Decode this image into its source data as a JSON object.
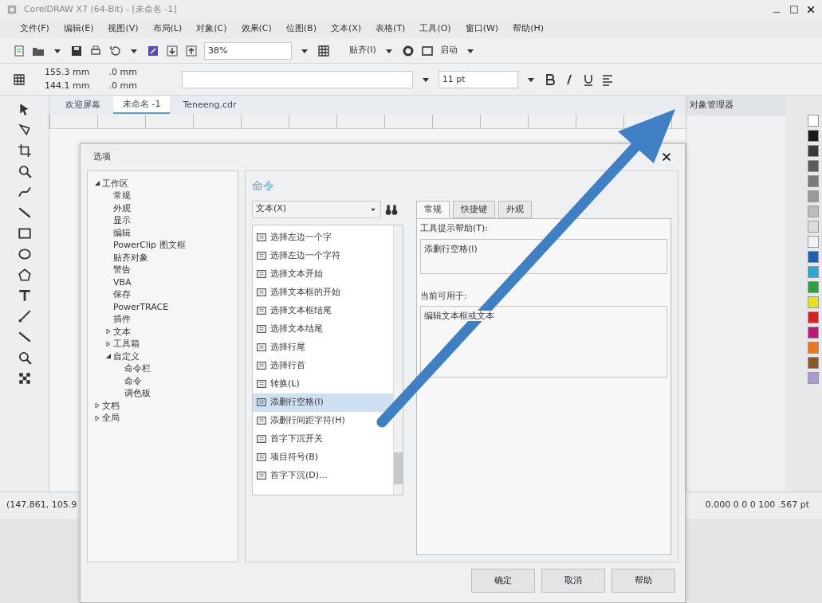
{
  "window": {
    "title": "CorelDRAW X7 (64-Bit) - [未命名 -1]"
  },
  "menu": [
    "文件(F)",
    "编辑(E)",
    "视图(V)",
    "布局(L)",
    "对象(C)",
    "效果(C)",
    "位图(B)",
    "文本(X)",
    "表格(T)",
    "工具(O)",
    "窗口(W)",
    "帮助(H)"
  ],
  "toolbar": {
    "zoom": "38%",
    "snap": "贴齐(I)",
    "launch": "启动"
  },
  "property_bar": {
    "width": "155.3 mm",
    "height": "144.1 mm",
    "offset_x": ".0 mm",
    "offset_y": ".0 mm",
    "font_size": "11 pt"
  },
  "doc_tabs": [
    {
      "label": "欢迎屏幕",
      "selected": false
    },
    {
      "label": "未命名 -1",
      "selected": true
    },
    {
      "label": "Teneeng.cdr",
      "selected": false
    }
  ],
  "docker": {
    "title": "对象管理器"
  },
  "palette": [
    {
      "color": "#ffffff"
    },
    {
      "color": "#1a1a1a"
    },
    {
      "color": "#3a3a3a"
    },
    {
      "color": "#5a5a5a"
    },
    {
      "color": "#7a7a7a"
    },
    {
      "color": "#9a9a9a"
    },
    {
      "color": "#bdbdbd"
    },
    {
      "color": "#dcdcdc"
    },
    {
      "color": "#f2f2f2"
    },
    {
      "color": "#1e5fb4"
    },
    {
      "color": "#2aa7d6"
    },
    {
      "color": "#2e9e3e"
    },
    {
      "color": "#e8e21c"
    },
    {
      "color": "#d61f26"
    },
    {
      "color": "#c0167a"
    },
    {
      "color": "#e97a1a"
    },
    {
      "color": "#8a5a2b"
    },
    {
      "color": "#a99bd0"
    }
  ],
  "status_bar": {
    "coordinates": "(147.861, 105.9",
    "fill_info": "0.000 0 0 0 100 .567 pt"
  },
  "dialog": {
    "title": "选项",
    "tree": [
      {
        "label": "工作区",
        "expanded": true,
        "children": [
          {
            "label": "常规"
          },
          {
            "label": "外观"
          },
          {
            "label": "显示"
          },
          {
            "label": "编辑"
          },
          {
            "label": "PowerClip 图文框"
          },
          {
            "label": "贴齐对象"
          },
          {
            "label": "警告"
          },
          {
            "label": "VBA"
          },
          {
            "label": "保存"
          },
          {
            "label": "PowerTRACE"
          },
          {
            "label": "插件"
          },
          {
            "label": "文本",
            "expanded": false
          },
          {
            "label": "工具箱",
            "expanded": false
          },
          {
            "label": "自定义",
            "expanded": true,
            "children": [
              {
                "label": "命令栏"
              },
              {
                "label": "命令"
              },
              {
                "label": "调色板"
              }
            ]
          }
        ]
      },
      {
        "label": "文档",
        "expanded": false
      },
      {
        "label": "全局",
        "expanded": false
      }
    ],
    "section_title": "命令",
    "category": "文本(X)",
    "commands": [
      {
        "label": "选择左边一个字",
        "selected": false
      },
      {
        "label": "选择左边一个字符",
        "selected": false
      },
      {
        "label": "选择文本开始",
        "selected": false
      },
      {
        "label": "选择文本框的开始",
        "selected": false
      },
      {
        "label": "选择文本框结尾",
        "selected": false
      },
      {
        "label": "选择文本结尾",
        "selected": false
      },
      {
        "label": "选择行尾",
        "selected": false
      },
      {
        "label": "选择行首",
        "selected": false
      },
      {
        "label": "转换(L)",
        "selected": false
      },
      {
        "label": "添删行空格(I)",
        "selected": true
      },
      {
        "label": "添删行间距字符(H)",
        "selected": false
      },
      {
        "label": "首字下沉开关",
        "selected": false
      },
      {
        "label": "项目符号(B)",
        "selected": false
      },
      {
        "label": "首字下沉(D)...",
        "selected": false
      }
    ],
    "tabs": [
      {
        "label": "常规",
        "selected": true
      },
      {
        "label": "快捷键",
        "selected": false
      },
      {
        "label": "外观",
        "selected": false
      }
    ],
    "tooltip_label": "工具提示帮助(T):",
    "tooltip_value": "添删行空格(I)",
    "available_label": "当前可用于:",
    "available_value": "编辑文本框或文本",
    "buttons": [
      "确定",
      "取消",
      "帮助"
    ]
  }
}
